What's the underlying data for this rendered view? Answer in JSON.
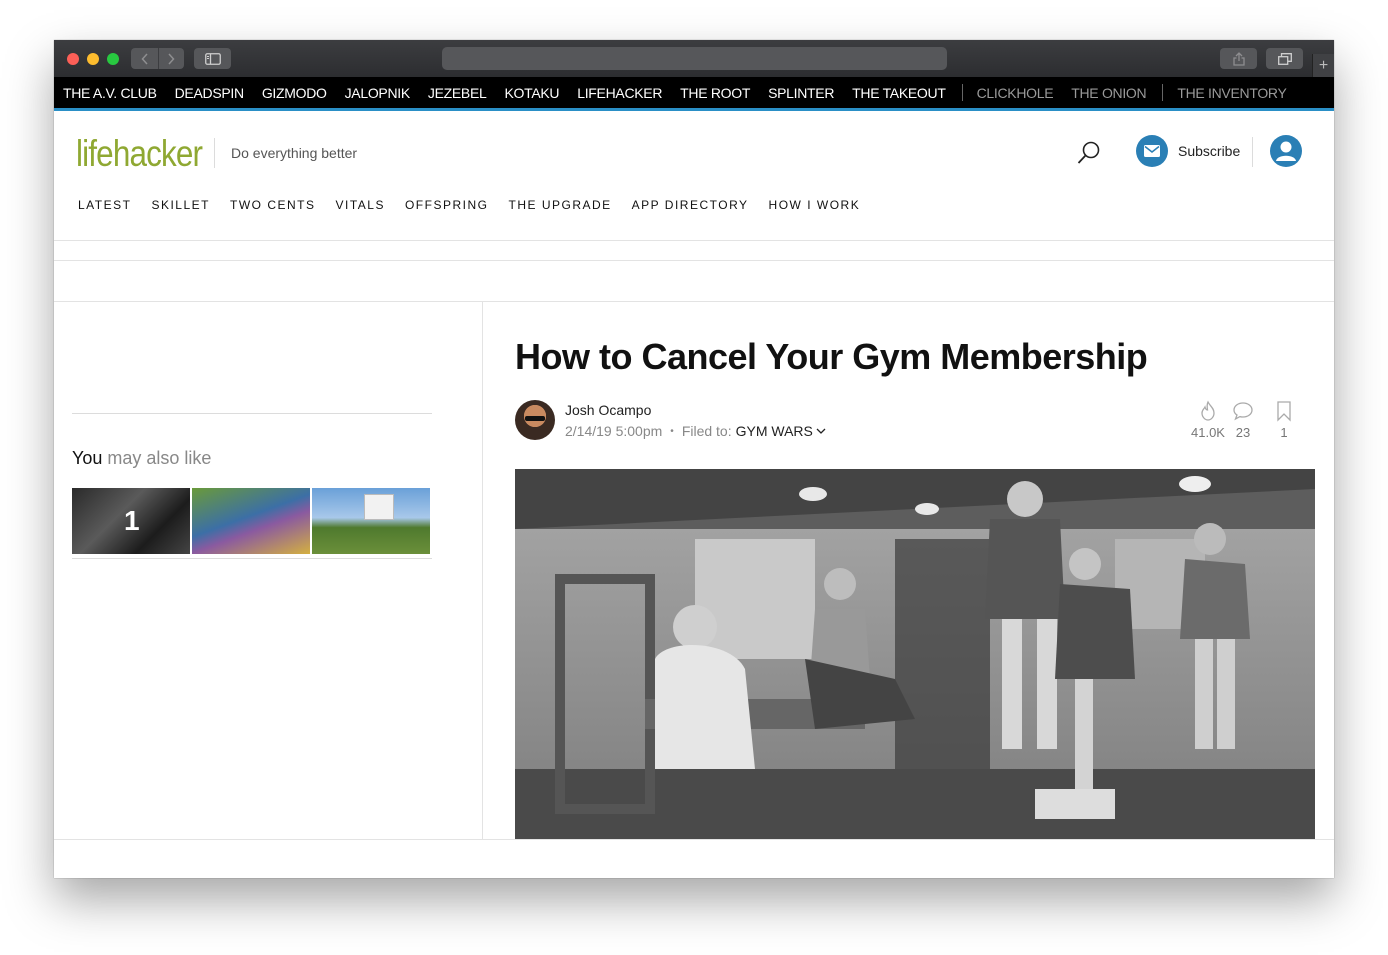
{
  "browser": {
    "back_icon": "chevron-left-icon",
    "forward_icon": "chevron-right-icon",
    "sidebar_icon": "sidebar-icon",
    "share_icon": "share-icon",
    "tabs_icon": "tabs-icon",
    "new_tab_label": "+"
  },
  "network": {
    "sites": [
      "THE A.V. CLUB",
      "DEADSPIN",
      "GIZMODO",
      "JALOPNIK",
      "JEZEBEL",
      "KOTAKU",
      "LIFEHACKER",
      "THE ROOT",
      "SPLINTER",
      "THE TAKEOUT"
    ],
    "partner_sites": [
      "CLICKHOLE",
      "THE ONION"
    ],
    "other_sites": [
      "THE INVENTORY"
    ]
  },
  "header": {
    "logo_life": "life",
    "logo_hacker": "hacker",
    "tagline": "Do everything better",
    "subscribe_label": "Subscribe",
    "accent_color": "#2a7fb5",
    "logo_color": "#8fa832"
  },
  "sections": [
    "LATEST",
    "SKILLET",
    "TWO CENTS",
    "VITALS",
    "OFFSPRING",
    "THE UPGRADE",
    "APP DIRECTORY",
    "HOW I WORK"
  ],
  "sidebar": {
    "you_label": "You",
    "may_also_like": " may also like",
    "thumb_1_number": "1"
  },
  "article": {
    "title": "How to Cancel Your Gym Membership",
    "author": "Josh Ocampo",
    "date": "2/14/19 5:00pm",
    "dot": "•",
    "filed_label": "Filed to:",
    "filed_value": "GYM WARS",
    "views": "41.0K",
    "comments": "23",
    "bookmarks": "1"
  }
}
